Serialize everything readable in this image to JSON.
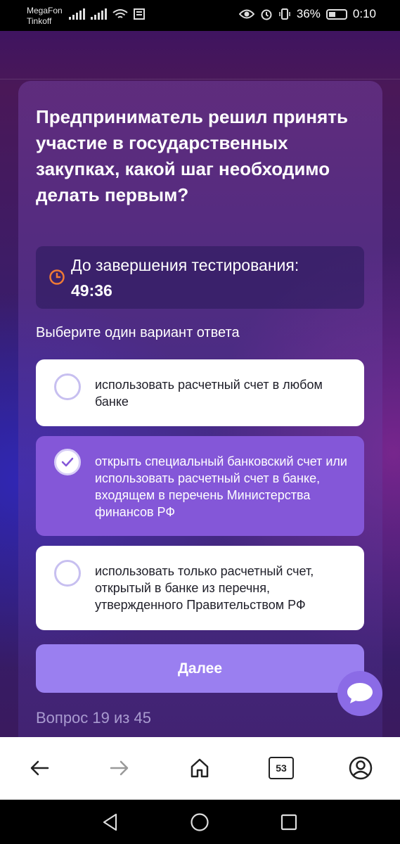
{
  "status_bar": {
    "carrier_1": "MegaFon",
    "carrier_2": "Tinkoff",
    "battery": "36%",
    "time": "0:10"
  },
  "question": {
    "text": "Предприниматель решил принять участие в государственных закупках, какой шаг необходимо делать первым?"
  },
  "timer": {
    "label": "До завершения тестирования:",
    "value": "49:36",
    "icon": "clock-icon",
    "icon_color": "#f07a35"
  },
  "instruction": "Выберите один вариант ответа",
  "options": [
    {
      "text": "использовать расчетный счет в любом банке",
      "selected": false
    },
    {
      "text": "открыть специальный банковский счет или использовать расчетный счет в банке, входящем в перечень Министерства финансов РФ",
      "selected": true
    },
    {
      "text": "использовать только расчетный счет, открытый в банке из перечня, утвержденного Правительством РФ",
      "selected": false
    }
  ],
  "next_button": {
    "label": "Далее",
    "color": "#9a7ff0"
  },
  "progress": "Вопрос 19 из 45",
  "browser_bar": {
    "tabs_count": "53",
    "icons": [
      "back-arrow-icon",
      "forward-arrow-icon",
      "home-icon",
      "tabs-icon",
      "profile-icon"
    ]
  },
  "colors": {
    "accent": "#8457d8",
    "chat": "#8b6be6"
  }
}
